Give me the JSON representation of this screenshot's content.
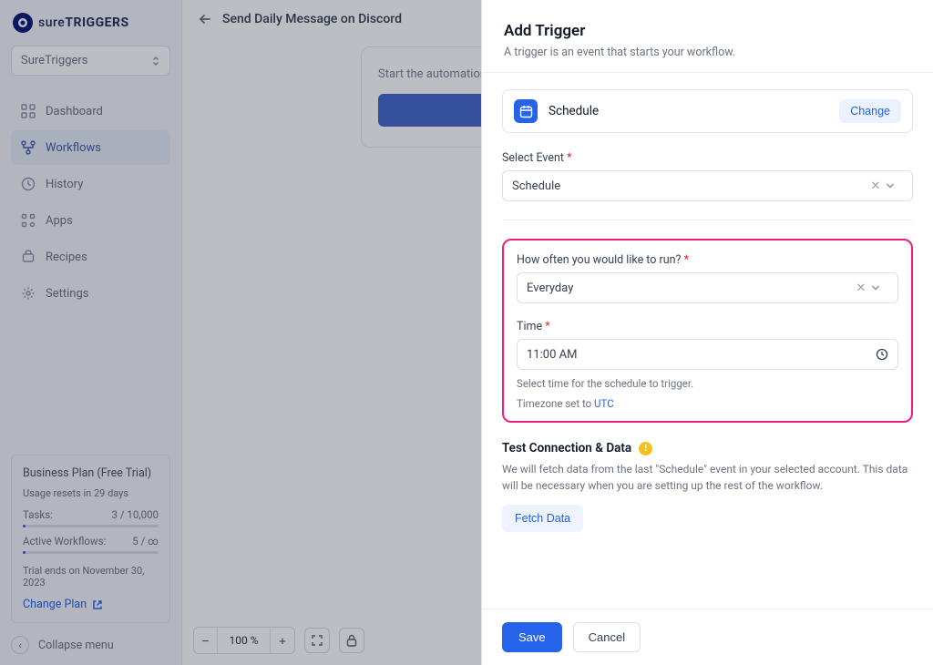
{
  "brand": {
    "prefix": "sure",
    "bold": "TRIGGERS"
  },
  "workspace": {
    "name": "SureTriggers"
  },
  "nav": {
    "dashboard": "Dashboard",
    "workflows": "Workflows",
    "history": "History",
    "apps": "Apps",
    "recipes": "Recipes",
    "settings": "Settings"
  },
  "plan": {
    "title": "Business Plan (Free Trial)",
    "usage": "Usage resets in 29 days",
    "tasks_label": "Tasks:",
    "tasks_value": "3 / 10,000",
    "workflows_label": "Active Workflows:",
    "workflows_value": "5 / ∞",
    "trial": "Trial ends on November 30, 2023",
    "change": "Change Plan"
  },
  "collapse": "Collapse menu",
  "topbar": {
    "title": "Send Daily Message on Discord"
  },
  "start": {
    "hint": "Start the automation with a trigger.."
  },
  "zoom": {
    "value": "100 %"
  },
  "panel": {
    "title": "Add Trigger",
    "subtitle": "A trigger is an event that starts your workflow.",
    "app_name": "Schedule",
    "change": "Change",
    "event_label": "Select Event",
    "event_value": "Schedule",
    "freq_label": "How often you would like to run?",
    "freq_value": "Everyday",
    "time_label": "Time",
    "time_value": "11:00 AM",
    "help1": "Select time for the schedule to trigger.",
    "help2": "Timezone set to ",
    "utc": "UTC",
    "test_title": "Test Connection & Data",
    "test_desc": "We will fetch data from the last \"Schedule\" event in your selected account. This data will be necessary when you are setting up the rest of the workflow.",
    "fetch": "Fetch Data",
    "save": "Save",
    "cancel": "Cancel"
  }
}
